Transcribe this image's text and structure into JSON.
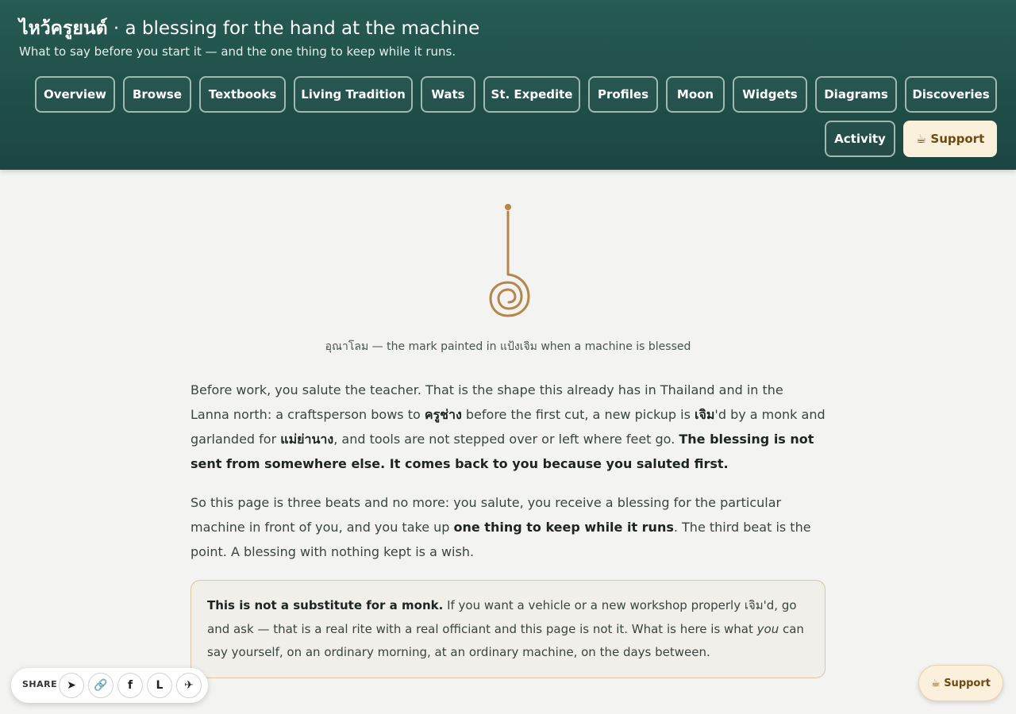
{
  "header": {
    "title_thai": "ไหว้ครูยนต์",
    "title_sep": " · ",
    "title_rest": "a blessing for the hand at the machine",
    "subtitle": "What to say before you start it — and the one thing to keep while it runs."
  },
  "nav": {
    "items": [
      "Overview",
      "Browse",
      "Textbooks",
      "Living Tradition",
      "Wats",
      "St. Expedite",
      "Profiles",
      "Moon",
      "Widgets",
      "Diagrams",
      "Discoveries",
      "Activity"
    ],
    "support_label": "☕ Support"
  },
  "emblem": {
    "color": "#b5854a",
    "icon": "unalom-icon"
  },
  "caption": "อุณาโลม — the mark painted in แป้งเจิม when a machine is blessed",
  "intro": {
    "p1_a": "Before work, you salute the teacher. That is the shape this already has in Thailand and in the Lanna north: a craftsperson bows to ",
    "p1_b": "ครูช่าง",
    "p1_c": " before the first cut, a new pickup is ",
    "p1_d": "เจิม",
    "p1_e": "'d by a monk and garlanded for ",
    "p1_f": "แม่ย่านาง",
    "p1_g": ", and tools are not stepped over or left where feet go. ",
    "p1_h": "The blessing is not sent from somewhere else. It comes back to you because you saluted first.",
    "p2_a": "So this page is three beats and no more: you salute, you receive a blessing for the particular machine in front of you, and you take up ",
    "p2_b": "one thing to keep while it runs",
    "p2_c": ". The third beat is the point. A blessing with nothing kept is a wish."
  },
  "callout": {
    "strong": "This is not a substitute for a monk.",
    "text_a": " If you want a vehicle or a new workshop properly เจิม'd, go and ask — that is a real rite with a real officiant and this page is not it. What is here is what ",
    "em": "you",
    "text_b": " can say yourself, on an ordinary morning, at an ordinary machine, on the days between."
  },
  "share": {
    "label": "SHARE",
    "buttons": [
      {
        "icon": "send-icon",
        "glyph": "➤"
      },
      {
        "icon": "link-icon",
        "glyph": "🔗"
      },
      {
        "icon": "facebook-icon",
        "glyph": "f"
      },
      {
        "icon": "line-icon",
        "glyph": "L"
      },
      {
        "icon": "telegram-icon",
        "glyph": "✈"
      }
    ]
  },
  "floating_support": {
    "label": "☕ Support"
  },
  "colors": {
    "header": "#1f4c47",
    "accent": "#b5854a",
    "support_bg": "#fbf0dc"
  }
}
